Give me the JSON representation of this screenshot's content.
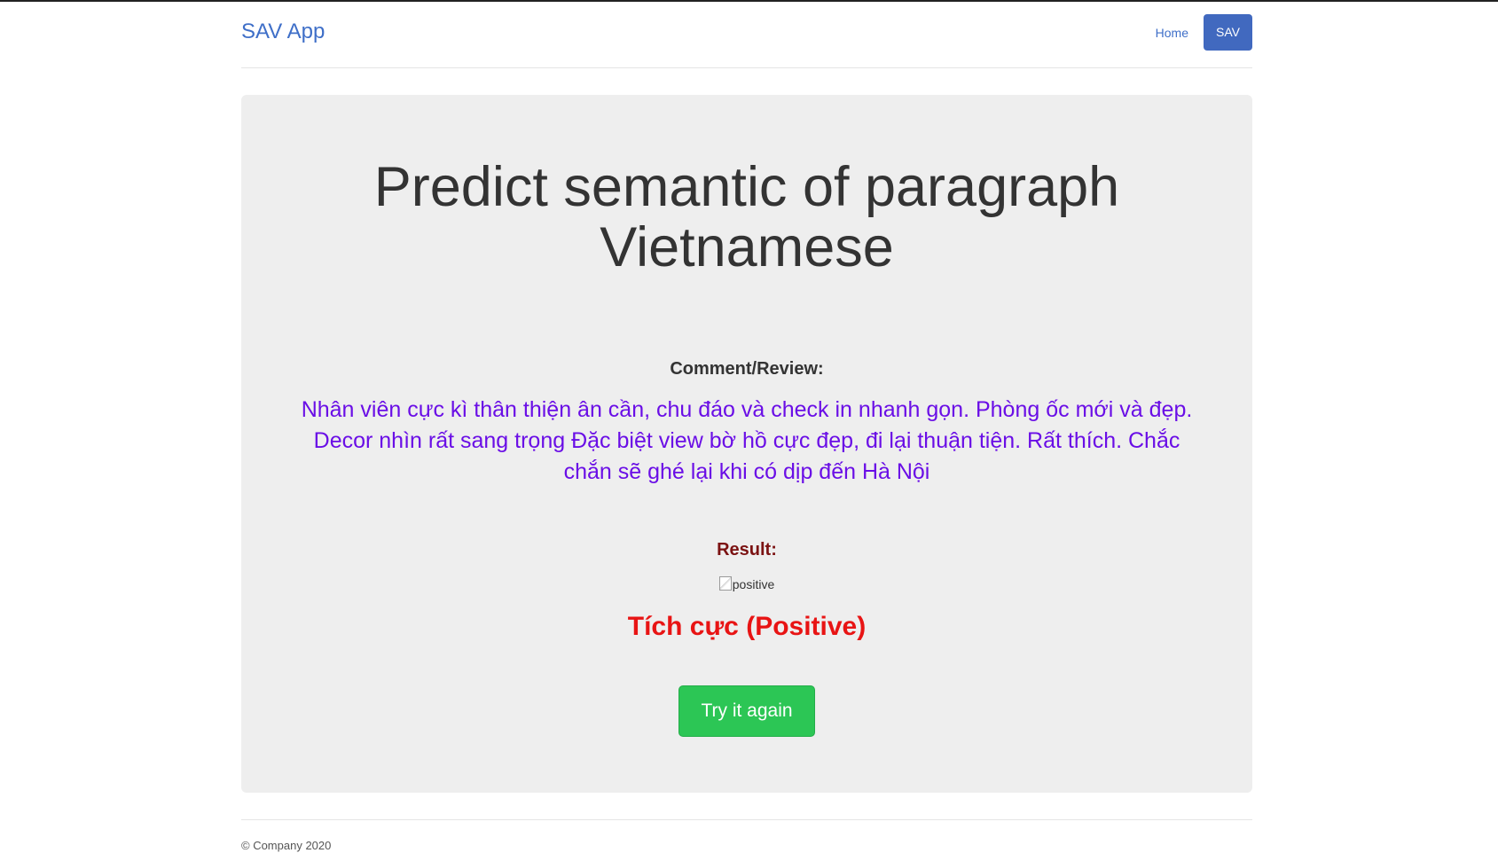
{
  "navbar": {
    "brand": "SAV App",
    "links": [
      {
        "label": "Home",
        "active": false
      },
      {
        "label": "SAV",
        "active": true
      }
    ]
  },
  "main": {
    "title": "Predict semantic of paragraph Vietnamese",
    "comment_label": "Comment/Review:",
    "comment_text": "Nhân viên cực kì thân thiện ân cần, chu đáo và check in nhanh gọn. Phòng ốc mới và đẹp. Decor nhìn rất sang trọng Đặc biệt view bờ hồ cực đẹp, đi lại thuận tiện. Rất thích. Chắc chắn sẽ ghé lại khi có dịp đến Hà Nội",
    "result_label": "Result:",
    "result_image_alt": "positive",
    "result_text": "Tích cực (Positive)",
    "try_again_label": "Try it again"
  },
  "footer": {
    "text": "© Company 2020"
  },
  "colors": {
    "brand": "#3f6fc8",
    "nav_active_bg": "#4169bf",
    "jumbotron_bg": "#eeeeee",
    "comment_text": "#6a0ee6",
    "result_label": "#7b1212",
    "result_text": "#e81414",
    "try_button_bg": "#2cc655"
  }
}
